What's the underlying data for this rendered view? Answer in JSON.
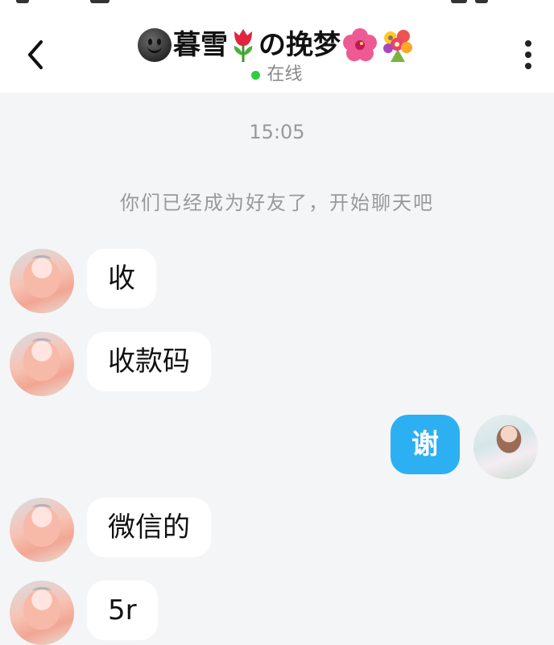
{
  "header": {
    "title_prefix": "暮雪",
    "title_middle": "の挽梦",
    "status": "在线",
    "icons": {
      "back": "chevron-left-icon",
      "face": "dark-smiley-face-icon",
      "tulip": "tulip-icon",
      "hibiscus": "hibiscus-icon",
      "bouquet": "bouquet-icon",
      "more": "more-vertical-icon"
    }
  },
  "chat": {
    "timestamp": "15:05",
    "system_message": "你们已经成为好友了，开始聊天吧",
    "messages": [
      {
        "sender": "other",
        "text": "收"
      },
      {
        "sender": "other",
        "text": "收款码"
      },
      {
        "sender": "me",
        "text": "谢"
      },
      {
        "sender": "other",
        "text": "微信的"
      },
      {
        "sender": "other",
        "text": "5r"
      }
    ]
  },
  "colors": {
    "accent": "#2cb0f2",
    "online": "#2ecc40",
    "background": "#f4f5f7"
  }
}
